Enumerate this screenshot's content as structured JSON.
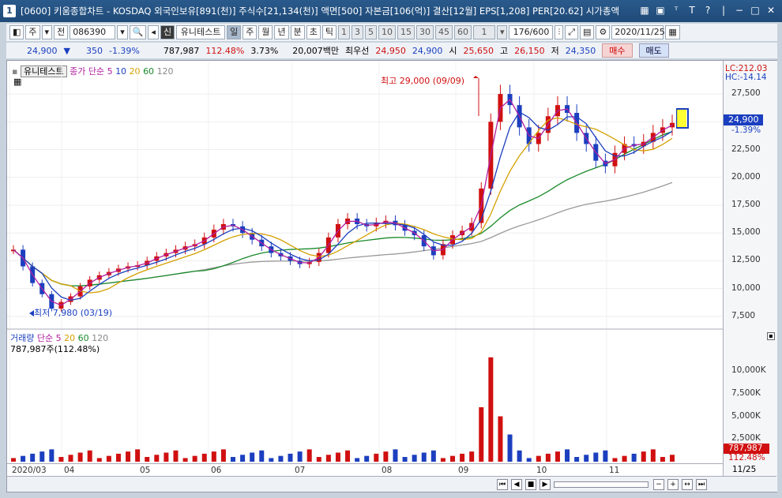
{
  "window": {
    "num": "1",
    "title": "[0600] 키움종합차트 - KOSDAQ 외국인보유[891(천)] 주식수[21,134(천)] 액면[500] 자본금[106(억)] 결산[12월] EPS[1,208] PER[20.62] 시가총액"
  },
  "toolbar": {
    "mode": "주",
    "mode2": "전",
    "code": "086390",
    "stock_name": "유니테스트",
    "badge": "신",
    "periods": [
      "일",
      "주",
      "월",
      "년",
      "분",
      "초",
      "틱"
    ],
    "active_period": "일",
    "minute_opts": [
      "1",
      "3",
      "5",
      "10",
      "15",
      "30",
      "45",
      "60"
    ],
    "count_box": "1",
    "page_count": "176/600",
    "date": "2020/11/25"
  },
  "quote": {
    "price": "24,900",
    "change": "350",
    "change_pct": "-1.39%",
    "volume": "787,987",
    "vol_ratio": "112.48%",
    "turnover": "3.73%",
    "amount": "20,007백만",
    "best_label": "최우선",
    "ask": "24,950",
    "bid": "24,900",
    "open_label": "시",
    "open": "25,650",
    "high_label": "고",
    "high": "26,150",
    "low_label": "저",
    "low": "24,350",
    "buy": "매수",
    "sell": "매도"
  },
  "legend": {
    "name": "유니테스트",
    "ma_label": "종가 단순",
    "ma5": "5",
    "ma10": "10",
    "ma20": "20",
    "ma60": "60",
    "ma120": "120"
  },
  "annotations": {
    "peak": "최고 29,000 (09/09)",
    "low": "최저 7,980 (03/19)"
  },
  "right_axis": {
    "lc": "LC:212.03",
    "hc": "HC:-14.14",
    "current": "24,900",
    "current_pct": "-1.39%",
    "vol_current": "787,987",
    "vol_pct": "112.48%"
  },
  "volume_legend": {
    "label": "거래량",
    "ma_label": "단순",
    "ma5": "5",
    "ma20": "20",
    "ma60": "60",
    "ma120": "120",
    "value": "787,987주(112.48%)"
  },
  "chart_data": {
    "type": "candlestick",
    "price_ticks": [
      "27,500",
      "25,000",
      "22,500",
      "20,000",
      "17,500",
      "15,000",
      "12,500",
      "10,000",
      "7,500"
    ],
    "volume_ticks": [
      "10,000K",
      "7,500K",
      "5,000K",
      "2,500K"
    ],
    "x_labels": [
      "2020/03",
      "04",
      "05",
      "06",
      "07",
      "08",
      "09",
      "10",
      "11",
      "11/25"
    ],
    "price_ylim": [
      6500,
      28500
    ],
    "close_approx": [
      13500,
      12000,
      10500,
      9500,
      8200,
      8800,
      9300,
      10200,
      10800,
      11200,
      11500,
      11800,
      12000,
      12100,
      12500,
      12900,
      13200,
      13500,
      13800,
      14000,
      14600,
      15300,
      15800,
      15600,
      15000,
      14400,
      13800,
      13200,
      12900,
      12500,
      12200,
      12400,
      13200,
      14600,
      15800,
      16300,
      15800,
      15600,
      15900,
      16100,
      15700,
      15200,
      14800,
      13800,
      13000,
      14000,
      14800,
      15200,
      15900,
      19000,
      25000,
      27500,
      26500,
      24500,
      23000,
      24000,
      25500,
      26500,
      25800,
      24000,
      23000,
      21500,
      21000,
      22200,
      23000,
      22800,
      23200,
      24000,
      24500,
      24900
    ],
    "ma120_end": 18500,
    "ma60_end": 23200
  }
}
